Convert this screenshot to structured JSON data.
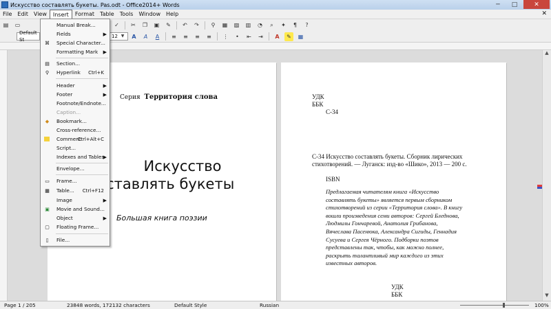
{
  "window": {
    "title": "Искусство составлять букеты. Pas.odt - Office2014+ Words",
    "controls": [
      "─",
      "□",
      "✕"
    ]
  },
  "menubar": {
    "items": [
      "File",
      "Edit",
      "View",
      "Insert",
      "Format",
      "Table",
      "Tools",
      "Window",
      "Help"
    ],
    "doc_close": "✕"
  },
  "formatting": {
    "style": "Default St",
    "font_size": "12"
  },
  "insert_menu": [
    {
      "label": "Manual Break...",
      "shortcut": "",
      "submenu": false,
      "disabled": false,
      "icon": ""
    },
    {
      "label": "Fields",
      "shortcut": "",
      "submenu": true,
      "disabled": false,
      "icon": ""
    },
    {
      "label": "Special Character...",
      "shortcut": "",
      "submenu": false,
      "disabled": false,
      "icon": "special-character-icon"
    },
    {
      "label": "Formatting Mark",
      "shortcut": "",
      "submenu": true,
      "disabled": false,
      "icon": ""
    },
    {
      "label": "Section...",
      "shortcut": "",
      "submenu": false,
      "disabled": false,
      "icon": "section-icon"
    },
    {
      "label": "Hyperlink",
      "shortcut": "Ctrl+K",
      "submenu": false,
      "disabled": false,
      "icon": "hyperlink-icon"
    },
    {
      "label": "Header",
      "shortcut": "",
      "submenu": true,
      "disabled": false,
      "icon": ""
    },
    {
      "label": "Footer",
      "shortcut": "",
      "submenu": true,
      "disabled": false,
      "icon": ""
    },
    {
      "label": "Footnote/Endnote...",
      "shortcut": "",
      "submenu": false,
      "disabled": false,
      "icon": ""
    },
    {
      "label": "Caption...",
      "shortcut": "",
      "submenu": false,
      "disabled": true,
      "icon": ""
    },
    {
      "label": "Bookmark...",
      "shortcut": "",
      "submenu": false,
      "disabled": false,
      "icon": "bookmark-icon"
    },
    {
      "label": "Cross-reference...",
      "shortcut": "",
      "submenu": false,
      "disabled": false,
      "icon": ""
    },
    {
      "label": "Comment",
      "shortcut": "Ctrl+Alt+C",
      "submenu": false,
      "disabled": false,
      "icon": "comment-icon"
    },
    {
      "label": "Script...",
      "shortcut": "",
      "submenu": false,
      "disabled": false,
      "icon": ""
    },
    {
      "label": "Indexes and Tables",
      "shortcut": "",
      "submenu": true,
      "disabled": false,
      "icon": ""
    },
    {
      "label": "Envelope...",
      "shortcut": "",
      "submenu": false,
      "disabled": false,
      "icon": ""
    },
    {
      "label": "Frame...",
      "shortcut": "",
      "submenu": false,
      "disabled": false,
      "icon": "frame-icon"
    },
    {
      "label": "Table...",
      "shortcut": "Ctrl+F12",
      "submenu": false,
      "disabled": false,
      "icon": "table-icon"
    },
    {
      "label": "Image",
      "shortcut": "",
      "submenu": true,
      "disabled": false,
      "icon": ""
    },
    {
      "label": "Movie and Sound...",
      "shortcut": "",
      "submenu": false,
      "disabled": false,
      "icon": "movie-icon"
    },
    {
      "label": "Object",
      "shortcut": "",
      "submenu": true,
      "disabled": false,
      "icon": ""
    },
    {
      "label": "Floating Frame...",
      "shortcut": "",
      "submenu": false,
      "disabled": false,
      "icon": "floating-frame-icon"
    },
    {
      "label": "File...",
      "shortcut": "",
      "submenu": false,
      "disabled": false,
      "icon": "file-icon"
    }
  ],
  "left_page": {
    "series_prefix": "Серия",
    "series_name": "Территория слова",
    "title_line1": "Искусство",
    "title_line2": "составлять букеты",
    "subtitle": "Большая книга поэзии"
  },
  "right_page": {
    "udk": "УДК",
    "bbk": "ББК",
    "code": "С-34",
    "biblio_line1": "С-34 Искусство составлять букеты. Сборник лирических",
    "biblio_line2": "стихотворений. — Луганск: изд-во «Шико», 2013 — 200 с.",
    "isbn": "ISBN",
    "annotation": [
      "Предлагаемая читателям книга «Искусство",
      "составлять букеты» является первым сборником",
      "стихотворений из серии «Территория слова». В книгу",
      "вошли произведения семи авторов: Сергей Бледнова,",
      "Людмилы Гончаревой, Анатолия Грибанова,",
      "Вячеслава Пасенюка, Александра Сигиды, Геннадия",
      "Сусуева и Сергея Чёрного. Подборки поэтов",
      "представлены так, чтобы, как можно полнее,",
      "раскрыть талантливый мир каждого из этих",
      "известных авторов."
    ],
    "udk2": "УДК",
    "bbk2": "ББК"
  },
  "status": {
    "page": "Page 1 / 205",
    "words": "23848 words, 172132 characters",
    "style": "Default Style",
    "language": "Russian",
    "zoom": "100%",
    "zoom_level": 1.0
  }
}
